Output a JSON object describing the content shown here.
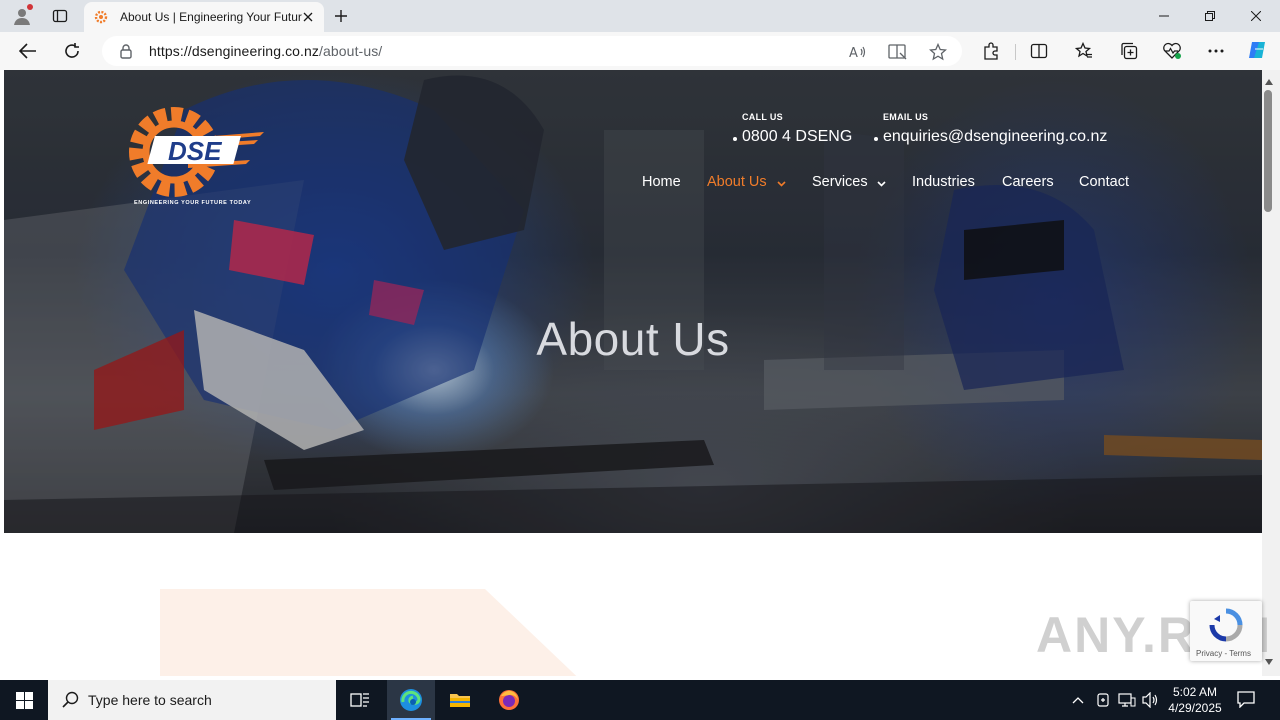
{
  "browser": {
    "tab_title": "About Us | Engineering Your Future Today",
    "url_host": "https://dsengineering.co.nz",
    "url_path": "/about-us/"
  },
  "site": {
    "logo_text": "DSE",
    "logo_tagline": "ENGINEERING YOUR FUTURE TODAY",
    "call_label": "CALL US",
    "call_value": "0800 4 DSENG",
    "email_label": "EMAIL US",
    "email_value": "enquiries@dsengineering.co.nz",
    "nav": [
      {
        "label": "Home"
      },
      {
        "label": "About Us"
      },
      {
        "label": "Services"
      },
      {
        "label": "Industries"
      },
      {
        "label": "Careers"
      },
      {
        "label": "Contact"
      }
    ],
    "hero_title": "About Us",
    "accent_color": "#f07c2a"
  },
  "overlay": {
    "recaptcha_links": "Privacy - Terms",
    "watermark": "ANY.RUN"
  },
  "taskbar": {
    "search_placeholder": "Type here to search",
    "time": "5:02 AM",
    "date": "4/29/2025"
  }
}
